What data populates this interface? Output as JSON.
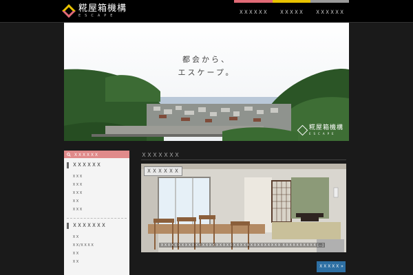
{
  "header": {
    "logo_title": "糀屋箱機構",
    "logo_sub": "ESCAPE",
    "nav": [
      {
        "label": "ＸＸＸＸＸＸ",
        "color": "#e06a76"
      },
      {
        "label": "ＸＸＸＸＸ",
        "color": "#e8c200"
      },
      {
        "label": "ＸＸＸＸＸＸ",
        "color": "#9a9a9a"
      }
    ]
  },
  "hero": {
    "catch_line1": "都会から、",
    "catch_line2": "エスケープ。",
    "logo_title": "糀屋箱機構",
    "logo_sub": "ESCAPE"
  },
  "sidebar": {
    "search_label": "ＸＸＸＸＸＸ",
    "section1_title": "ＸＸＸＸＸＸ",
    "section1_items": [
      "ＸＸＸ",
      "ＸＸＸ",
      "ＸＸＸ",
      "ＸＸ",
      "ＸＸＸ"
    ],
    "section2_title": "ＸＸＸＸＸＸＸ",
    "section2_items": [
      "ＸＸ",
      "ＸＸ/ＸＸＸＸ",
      "ＸＸ",
      "ＸＸ"
    ]
  },
  "main": {
    "section_title": "ＸＸＸＸＸＸＸ",
    "post_label": "ＸＸＸＸＸＸ",
    "post_excerpt": "ＸＸＸＸＸＸＸＸＸＸＸＸＸＸＸＸＸＸＸＸＸＸＸＸＸＸＸＸＸＸＸＸＸＸＸ ＸＸＸＸＸＸＸＸＸＸ [...]",
    "more_button": "ＸＸＸＸＸ »"
  }
}
